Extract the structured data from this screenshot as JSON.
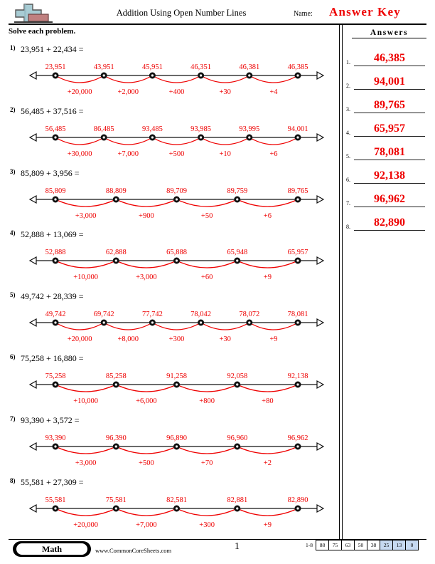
{
  "header": {
    "title": "Addition Using Open Number Lines",
    "name_label": "Name:",
    "answer_key": "Answer Key",
    "logo_name": "plus-block-logo"
  },
  "instruction": "Solve each problem.",
  "answers_panel": {
    "title": "Answers",
    "items": [
      {
        "num": "1.",
        "value": "46,385"
      },
      {
        "num": "2.",
        "value": "94,001"
      },
      {
        "num": "3.",
        "value": "89,765"
      },
      {
        "num": "4.",
        "value": "65,957"
      },
      {
        "num": "5.",
        "value": "78,081"
      },
      {
        "num": "6.",
        "value": "92,138"
      },
      {
        "num": "7.",
        "value": "96,962"
      },
      {
        "num": "8.",
        "value": "82,890"
      }
    ]
  },
  "problems": [
    {
      "num": "1)",
      "expression": "23,951 + 22,434 =",
      "points": [
        "23,951",
        "43,951",
        "45,951",
        "46,351",
        "46,381",
        "46,385"
      ],
      "jumps": [
        "+20,000",
        "+2,000",
        "+400",
        "+30",
        "+4"
      ]
    },
    {
      "num": "2)",
      "expression": "56,485 + 37,516 =",
      "points": [
        "56,485",
        "86,485",
        "93,485",
        "93,985",
        "93,995",
        "94,001"
      ],
      "jumps": [
        "+30,000",
        "+7,000",
        "+500",
        "+10",
        "+6"
      ]
    },
    {
      "num": "3)",
      "expression": "85,809 + 3,956 =",
      "points": [
        "85,809",
        "88,809",
        "89,709",
        "89,759",
        "89,765"
      ],
      "jumps": [
        "+3,000",
        "+900",
        "+50",
        "+6"
      ]
    },
    {
      "num": "4)",
      "expression": "52,888 + 13,069 =",
      "points": [
        "52,888",
        "62,888",
        "65,888",
        "65,948",
        "65,957"
      ],
      "jumps": [
        "+10,000",
        "+3,000",
        "+60",
        "+9"
      ]
    },
    {
      "num": "5)",
      "expression": "49,742 + 28,339 =",
      "points": [
        "49,742",
        "69,742",
        "77,742",
        "78,042",
        "78,072",
        "78,081"
      ],
      "jumps": [
        "+20,000",
        "+8,000",
        "+300",
        "+30",
        "+9"
      ]
    },
    {
      "num": "6)",
      "expression": "75,258 + 16,880 =",
      "points": [
        "75,258",
        "85,258",
        "91,258",
        "92,058",
        "92,138"
      ],
      "jumps": [
        "+10,000",
        "+6,000",
        "+800",
        "+80"
      ]
    },
    {
      "num": "7)",
      "expression": "93,390 + 3,572 =",
      "points": [
        "93,390",
        "96,390",
        "96,890",
        "96,960",
        "96,962"
      ],
      "jumps": [
        "+3,000",
        "+500",
        "+70",
        "+2"
      ]
    },
    {
      "num": "8)",
      "expression": "55,581 + 27,309 =",
      "points": [
        "55,581",
        "75,581",
        "82,581",
        "82,881",
        "82,890"
      ],
      "jumps": [
        "+20,000",
        "+7,000",
        "+300",
        "+9"
      ]
    }
  ],
  "footer": {
    "subject": "Math",
    "url": "www.CommonCoreSheets.com",
    "page_number": "1",
    "score_range": "1-8",
    "score_values": [
      "88",
      "75",
      "63",
      "50",
      "38",
      "25",
      "13",
      "0"
    ],
    "score_highlighted": [
      "25",
      "13",
      "0"
    ]
  },
  "colors": {
    "red": "#ee0000",
    "highlight": "#c6d9f1",
    "logo_plus": "#a8ccd4",
    "logo_block": "#c08080"
  }
}
